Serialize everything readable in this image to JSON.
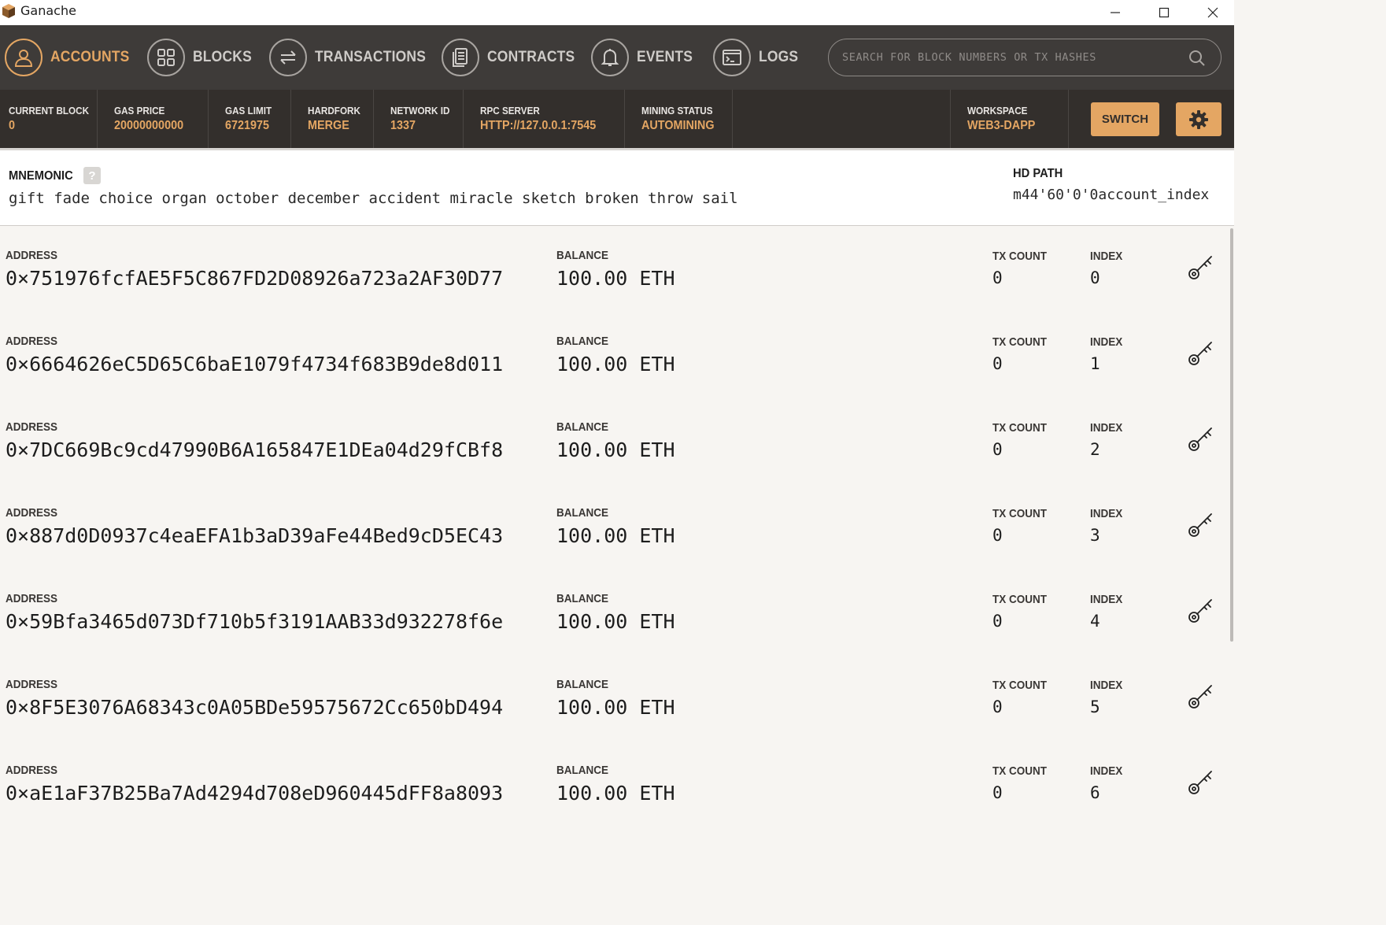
{
  "window": {
    "title": "Ganache"
  },
  "nav": {
    "items": [
      {
        "label": "ACCOUNTS",
        "icon": "user-icon",
        "active": true
      },
      {
        "label": "BLOCKS",
        "icon": "blocks-icon",
        "active": false
      },
      {
        "label": "TRANSACTIONS",
        "icon": "transfer-icon",
        "active": false
      },
      {
        "label": "CONTRACTS",
        "icon": "document-icon",
        "active": false
      },
      {
        "label": "EVENTS",
        "icon": "bell-icon",
        "active": false
      },
      {
        "label": "LOGS",
        "icon": "terminal-icon",
        "active": false
      }
    ],
    "search_placeholder": "SEARCH FOR BLOCK NUMBERS OR TX HASHES"
  },
  "status": {
    "current_block": {
      "label": "CURRENT BLOCK",
      "value": "0"
    },
    "gas_price": {
      "label": "GAS PRICE",
      "value": "20000000000"
    },
    "gas_limit": {
      "label": "GAS LIMIT",
      "value": "6721975"
    },
    "hardfork": {
      "label": "HARDFORK",
      "value": "MERGE"
    },
    "network_id": {
      "label": "NETWORK ID",
      "value": "1337"
    },
    "rpc_server": {
      "label": "RPC SERVER",
      "value": "HTTP://127.0.0.1:7545"
    },
    "mining_status": {
      "label": "MINING STATUS",
      "value": "AUTOMINING"
    },
    "workspace": {
      "label": "WORKSPACE",
      "value": "WEB3-DAPP"
    },
    "switch_label": "SWITCH"
  },
  "mnemonic": {
    "label": "MNEMONIC",
    "help": "?",
    "words": "gift fade choice organ october december accident miracle sketch broken throw sail",
    "hd_path_label": "HD PATH",
    "hd_path": "m44'60'0'0account_index"
  },
  "labels": {
    "address": "ADDRESS",
    "balance": "BALANCE",
    "tx_count": "TX COUNT",
    "index": "INDEX"
  },
  "accounts": [
    {
      "address": "0×751976fcfAE5F5C867FD2D08926a723a2AF30D77",
      "balance": "100.00 ETH",
      "tx_count": "0",
      "index": "0"
    },
    {
      "address": "0×6664626eC5D65C6baE1079f4734f683B9de8d011",
      "balance": "100.00 ETH",
      "tx_count": "0",
      "index": "1"
    },
    {
      "address": "0×7DC669Bc9cd47990B6A165847E1DEa04d29fCBf8",
      "balance": "100.00 ETH",
      "tx_count": "0",
      "index": "2"
    },
    {
      "address": "0×887d0D0937c4eaEFA1b3aD39aFe44Bed9cD5EC43",
      "balance": "100.00 ETH",
      "tx_count": "0",
      "index": "3"
    },
    {
      "address": "0×59Bfa3465d073Df710b5f3191AAB33d932278f6e",
      "balance": "100.00 ETH",
      "tx_count": "0",
      "index": "4"
    },
    {
      "address": "0×8F5E3076A68343c0A05BDe59575672Cc650bD494",
      "balance": "100.00 ETH",
      "tx_count": "0",
      "index": "5"
    },
    {
      "address": "0×aE1aF37B25Ba7Ad4294d708eD960445dFF8a8093",
      "balance": "100.00 ETH",
      "tx_count": "0",
      "index": "6"
    }
  ],
  "colors": {
    "accent": "#e4a663",
    "nav_bg": "#3e3b39",
    "status_bg": "#332f2c",
    "content_bg": "#f7f5f2"
  }
}
